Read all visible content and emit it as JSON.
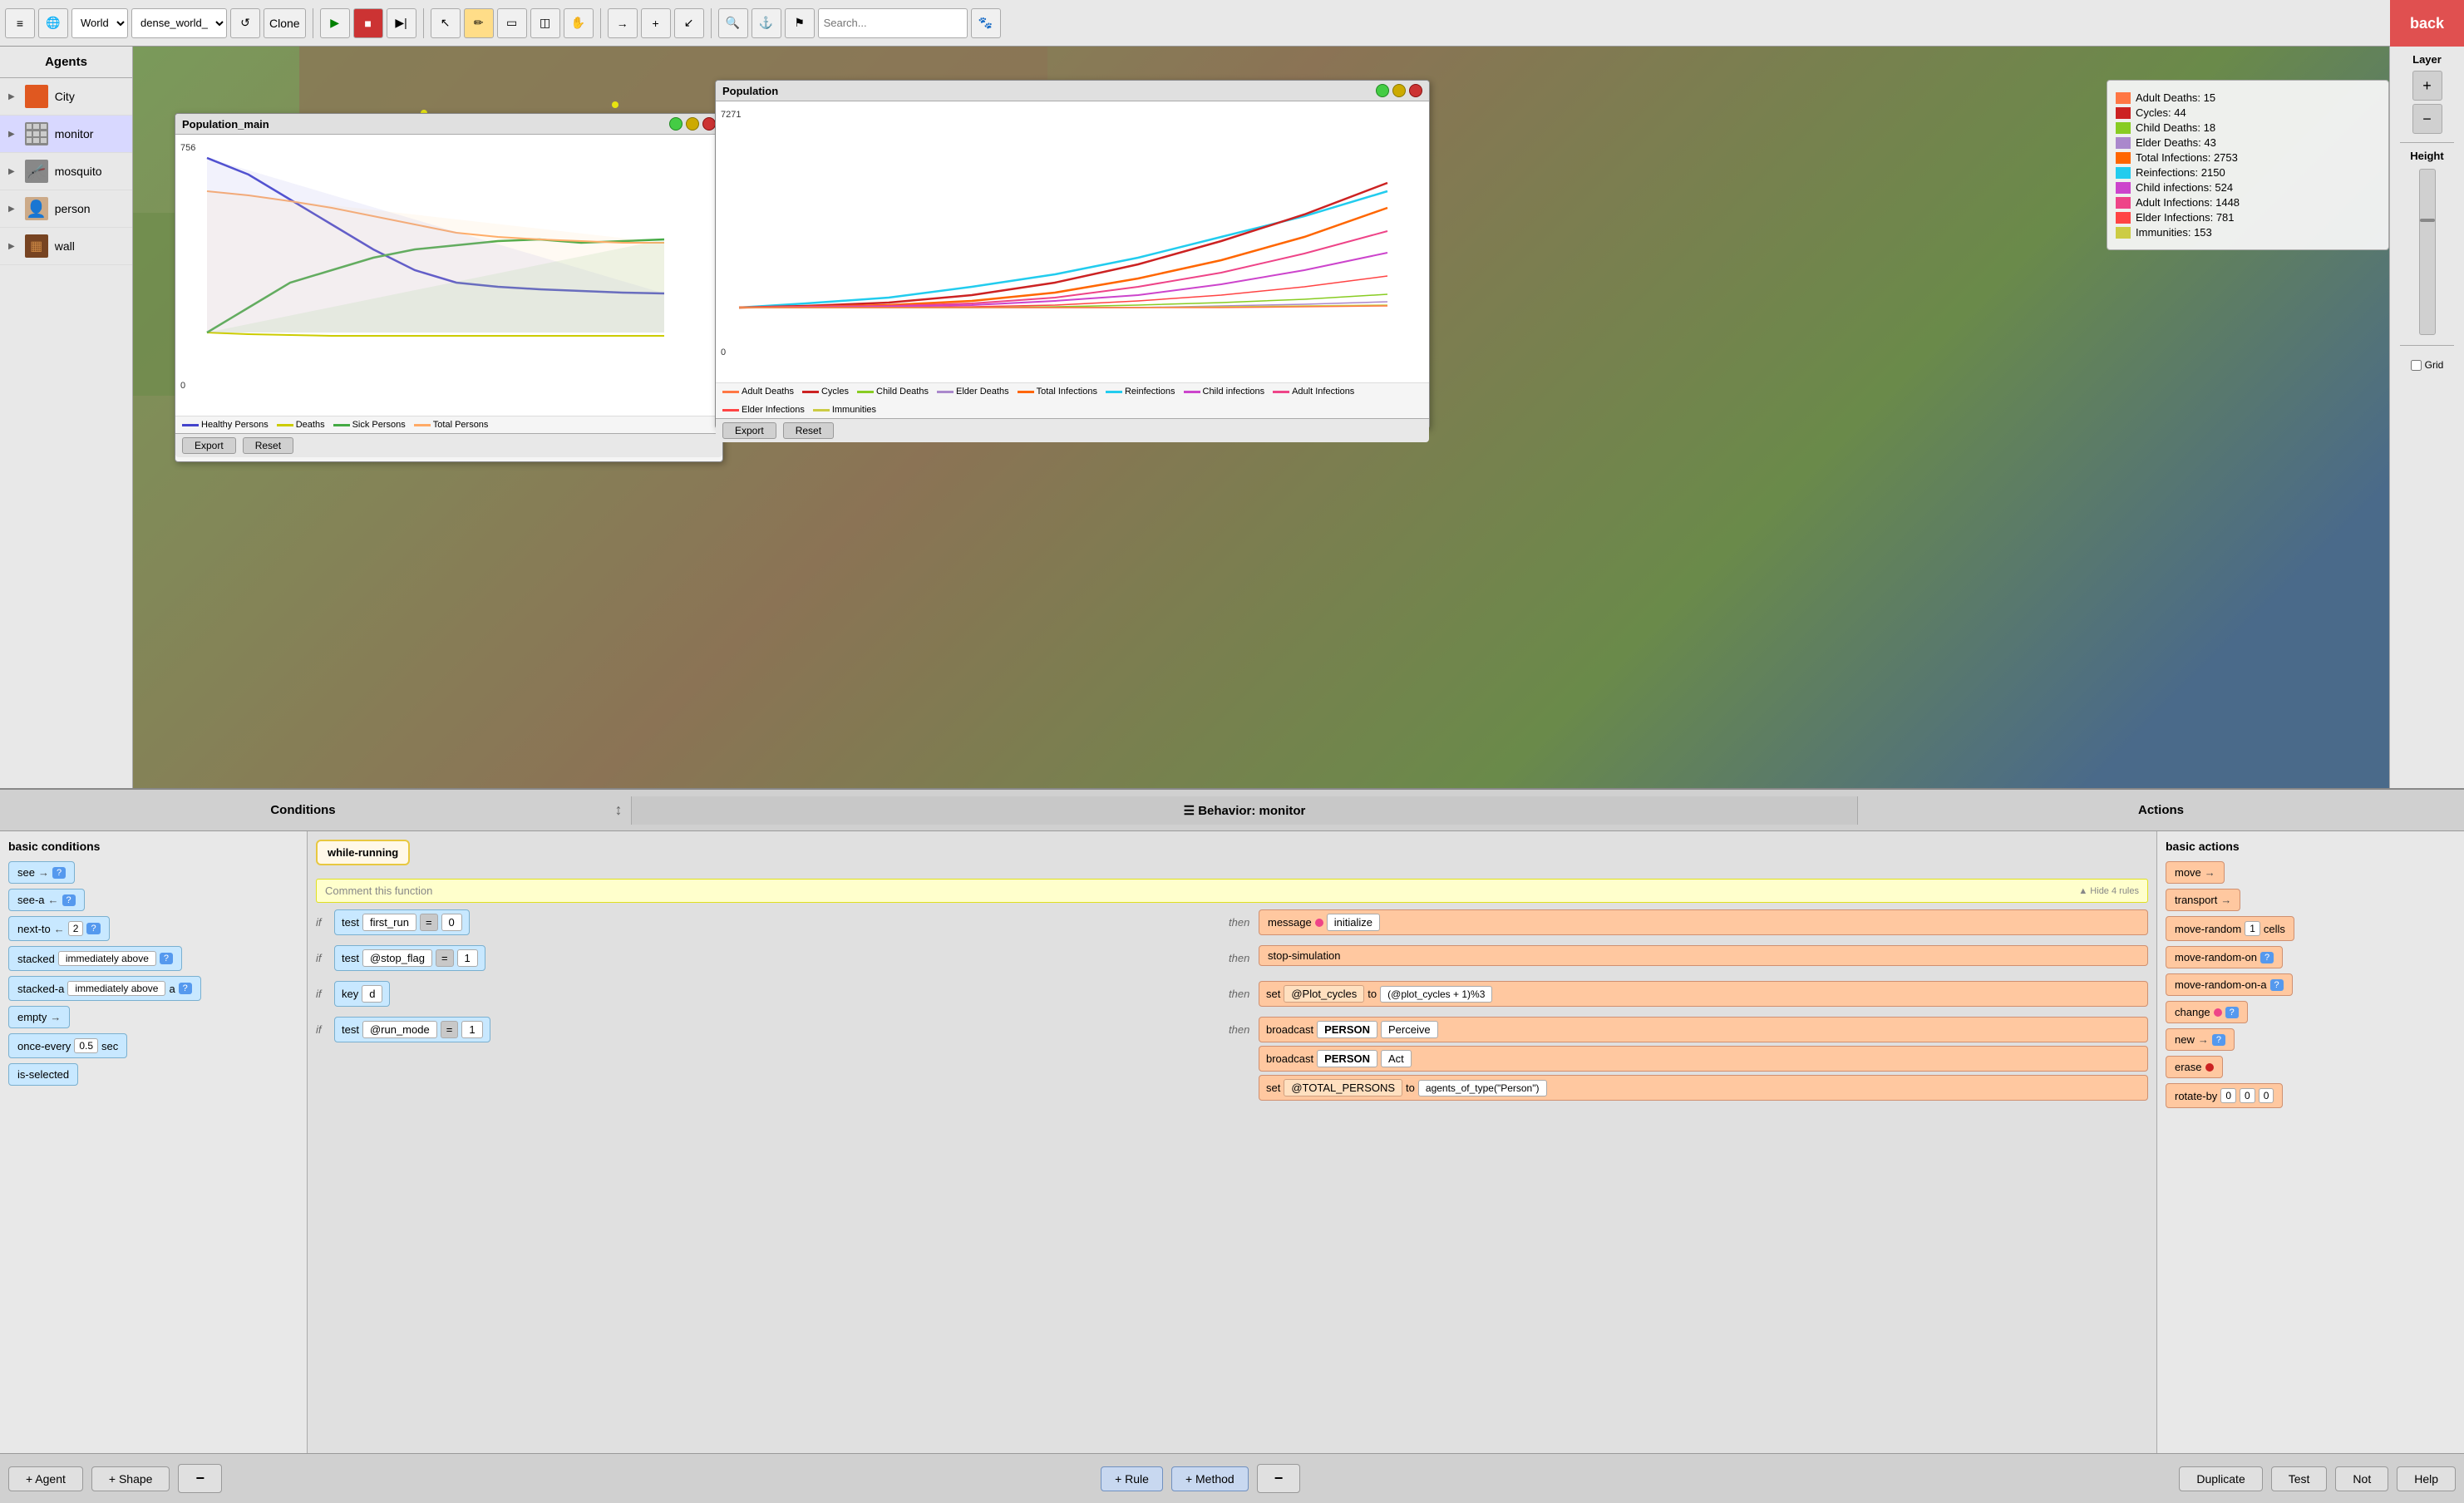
{
  "toolbar": {
    "world_label": "World",
    "world_value": "dense_world_",
    "back_label": "back",
    "clone_label": "Clone"
  },
  "agents": {
    "header": "Agents",
    "items": [
      {
        "id": "city",
        "label": "City",
        "color": "#e05820",
        "icon": "square"
      },
      {
        "id": "monitor",
        "label": "monitor",
        "color": "#666",
        "icon": "grid"
      },
      {
        "id": "mosquito",
        "label": "mosquito",
        "color": "#444",
        "icon": "bug"
      },
      {
        "id": "person",
        "label": "person",
        "color": "#886644",
        "icon": "person"
      },
      {
        "id": "wall",
        "label": "wall",
        "color": "#774422",
        "icon": "wall"
      }
    ]
  },
  "pop_main_chart": {
    "title": "Population_main",
    "y_max": "756",
    "y_min": "0",
    "export_label": "Export",
    "reset_label": "Reset",
    "legend": [
      {
        "label": "Healthy Persons",
        "color": "#4444cc"
      },
      {
        "label": "Deaths",
        "color": "#cccc00"
      },
      {
        "label": "Sick Persons",
        "color": "#44aa44"
      },
      {
        "label": "Total Persons",
        "color": "#ffaa66"
      }
    ]
  },
  "pop_chart": {
    "title": "Population",
    "y_max": "7271",
    "y_min": "0",
    "export_label": "Export",
    "reset_label": "Reset",
    "legend": [
      {
        "label": "Adult Deaths",
        "color": "#ff7744"
      },
      {
        "label": "Cycles",
        "color": "#cc2222"
      },
      {
        "label": "Child Deaths",
        "color": "#88cc22"
      },
      {
        "label": "Elder Deaths",
        "color": "#aa88cc"
      },
      {
        "label": "Total Infections",
        "color": "#ff6600"
      },
      {
        "label": "Reinfections",
        "color": "#22ccee"
      },
      {
        "label": "Child infections",
        "color": "#cc44cc"
      },
      {
        "label": "Adult Infections",
        "color": "#ee4488"
      },
      {
        "label": "Elder Infections",
        "color": "#ff4444"
      },
      {
        "label": "Immunities",
        "color": "#cccc44"
      }
    ]
  },
  "right_stats": {
    "items": [
      {
        "label": "Adult Deaths: 15",
        "color": "#ff7744"
      },
      {
        "label": "Cycles: 44",
        "color": "#cc2222"
      },
      {
        "label": "Child Deaths: 18",
        "color": "#88cc22"
      },
      {
        "label": "Elder Deaths: 43",
        "color": "#aa88cc"
      },
      {
        "label": "Total Infections: 2753",
        "color": "#ff6600"
      },
      {
        "label": "Reinfections: 2150",
        "color": "#22ccee"
      },
      {
        "label": "Child infections: 524",
        "color": "#cc44cc"
      },
      {
        "label": "Adult Infections: 1448",
        "color": "#ee4488"
      },
      {
        "label": "Elder Infections: 781",
        "color": "#ff4444"
      },
      {
        "label": "Immunities: 153",
        "color": "#cccc44"
      }
    ]
  },
  "right_panel": {
    "layer_label": "Layer",
    "height_label": "Height",
    "grid_label": "Grid",
    "plus_label": "+",
    "minus_label": "−"
  },
  "bottom": {
    "conditions_title": "Conditions",
    "behavior_label": "☰  Behavior: monitor",
    "actions_title": "Actions",
    "basic_conditions_title": "basic conditions",
    "basic_actions_title": "basic actions",
    "resize_icon": "↕",
    "conditions": [
      {
        "id": "see",
        "label": "see",
        "arrow": "→",
        "has_help": true
      },
      {
        "id": "see-a",
        "label": "see-a",
        "arrow": "←",
        "has_help": true
      },
      {
        "id": "next-to",
        "label": "next-to",
        "arrow": "=",
        "num": "2",
        "has_help": true
      },
      {
        "id": "stacked",
        "label": "stacked",
        "text": "immediately above",
        "has_help": true
      },
      {
        "id": "stacked-a",
        "label": "stacked-a",
        "text": "immediately above",
        "sub": "a",
        "has_help": false
      },
      {
        "id": "empty",
        "label": "empty",
        "arrow": "→",
        "has_help": false
      },
      {
        "id": "once-every",
        "label": "once-every",
        "num": "0.5",
        "unit": "sec",
        "has_help": false
      },
      {
        "id": "is-selected",
        "label": "is-selected",
        "has_help": false
      }
    ],
    "rules": {
      "while_running": "while-running",
      "comment_placeholder": "Comment this function",
      "hide_rules": "▲ Hide 4 rules",
      "rule1": {
        "if_test": "test",
        "var": "first_run",
        "eq": "=",
        "val": "0",
        "then_action": "message",
        "then_val": "initialize"
      },
      "rule2": {
        "if_test": "test",
        "var": "@stop_flag",
        "eq": "=",
        "val": "1",
        "then_action": "stop-simulation"
      },
      "rule3": {
        "if_key": "key",
        "key_val": "d",
        "then_set": "set",
        "then_var": "@Plot_cycles",
        "then_to": "to",
        "then_expr": "(@plot_cycles + 1)%3"
      },
      "rule4": {
        "if_test": "test",
        "var": "@run_mode",
        "eq": "=",
        "val": "1",
        "then_broadcast1_label": "broadcast",
        "then_broadcast1_person": "PERSON",
        "then_broadcast1_act": "Perceive",
        "then_broadcast2_label": "broadcast",
        "then_broadcast2_person": "PERSON",
        "then_broadcast2_act": "Act",
        "then_set": "set",
        "then_var": "@TOTAL_PERSONS",
        "then_to": "to",
        "then_expr": "agents_of_type(\"Person\")"
      }
    },
    "actions": [
      {
        "label": "move",
        "arrow": "→"
      },
      {
        "label": "transport",
        "arrow": "→"
      },
      {
        "label": "move-random",
        "num": "1",
        "unit": "cells"
      },
      {
        "label": "move-random-on",
        "has_help": true
      },
      {
        "label": "move-random-on-a",
        "has_help": true
      },
      {
        "label": "change",
        "has_help": true
      },
      {
        "label": "new",
        "arrow": "→",
        "has_help": true
      },
      {
        "label": "erase"
      },
      {
        "label": "rotate-by",
        "nums": [
          "0",
          "0",
          "0"
        ]
      }
    ],
    "toolbar": {
      "add_agent": "+ Agent",
      "add_shape": "+ Shape",
      "minus": "−",
      "add_rule": "+ Rule",
      "add_method": "+ Method",
      "minus2": "−",
      "duplicate": "Duplicate",
      "test": "Test",
      "not": "Not",
      "help": "Help"
    }
  }
}
